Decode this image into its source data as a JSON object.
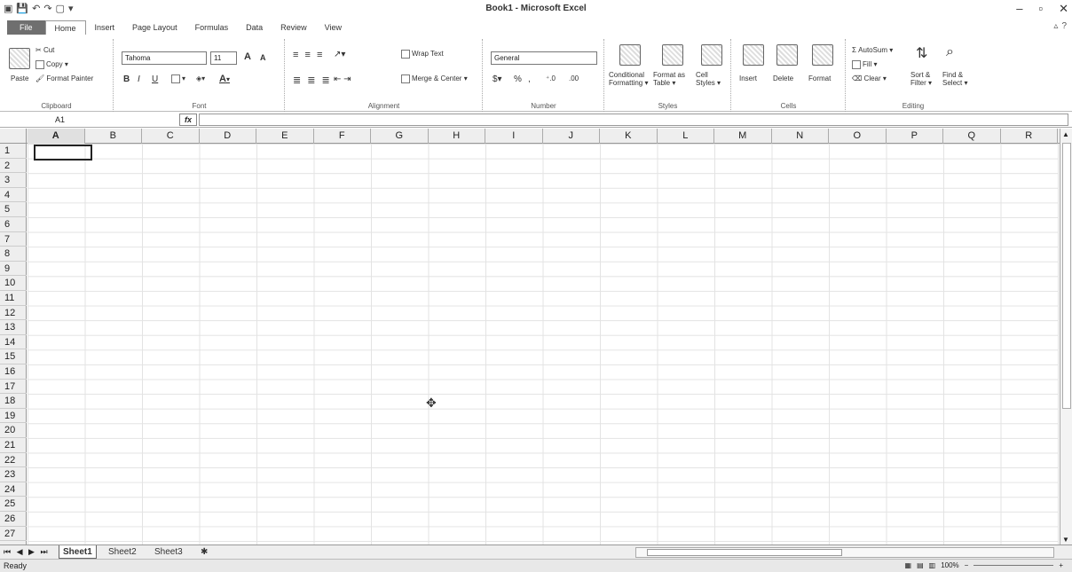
{
  "window": {
    "title": "Book1 - Microsoft Excel",
    "minimize": "–",
    "restore": "▫",
    "close": "✕"
  },
  "qat": [
    "▣",
    "💾",
    "↶",
    "↷",
    "▢",
    "▾"
  ],
  "tabs": [
    "File",
    "Home",
    "Insert",
    "Page Layout",
    "Formulas",
    "Data",
    "Review",
    "View"
  ],
  "active_tab": "Home",
  "clipboard": {
    "paste": "Paste",
    "cut": "Cut",
    "copy": "Copy ▾",
    "format_painter": "Format Painter",
    "label": "Clipboard"
  },
  "font": {
    "name": "Tahoma",
    "size": "11",
    "grow": "A",
    "shrink": "A",
    "bold": "B",
    "italic": "I",
    "underline": "U",
    "label": "Font"
  },
  "alignment": {
    "wrap_text": "Wrap Text",
    "merge_center": "Merge & Center ▾",
    "label": "Alignment"
  },
  "number": {
    "format": "General",
    "percent": "%",
    "comma": ",",
    "label": "Number"
  },
  "styles": {
    "conditional": "Conditional Formatting ▾",
    "format_table": "Format as Table ▾",
    "cell_styles": "Cell Styles ▾",
    "label": "Styles"
  },
  "cells_group": {
    "insert": "Insert",
    "delete": "Delete",
    "format": "Format",
    "label": "Cells"
  },
  "editing": {
    "autosum": "Σ AutoSum ▾",
    "fill": "Fill ▾",
    "clear": "Clear ▾",
    "sort_filter": "Sort & Filter ▾",
    "find_select": "Find & Select ▾",
    "label": "Editing"
  },
  "formula_bar": {
    "name_box": "A1",
    "fx": "fx",
    "value": ""
  },
  "columns": [
    "A",
    "B",
    "C",
    "D",
    "E",
    "F",
    "G",
    "H",
    "I",
    "J",
    "K",
    "L",
    "M",
    "N",
    "O",
    "P",
    "Q",
    "R"
  ],
  "selected_column": "A",
  "rows": [
    "1",
    "2",
    "3",
    "4",
    "5",
    "6",
    "7",
    "8",
    "9",
    "10",
    "11",
    "12",
    "13",
    "14",
    "15",
    "16",
    "17",
    "18",
    "19",
    "20",
    "21",
    "22",
    "23",
    "24",
    "25",
    "26",
    "27"
  ],
  "active_cell": "A1",
  "sheet_nav": "⏮ ◀ ▶ ⏭",
  "sheets": [
    "Sheet1",
    "Sheet2",
    "Sheet3",
    "✱"
  ],
  "active_sheet": "Sheet1",
  "status": {
    "ready": "Ready",
    "zoom": "100%",
    "zoom_out": "−",
    "zoom_in": "+"
  }
}
